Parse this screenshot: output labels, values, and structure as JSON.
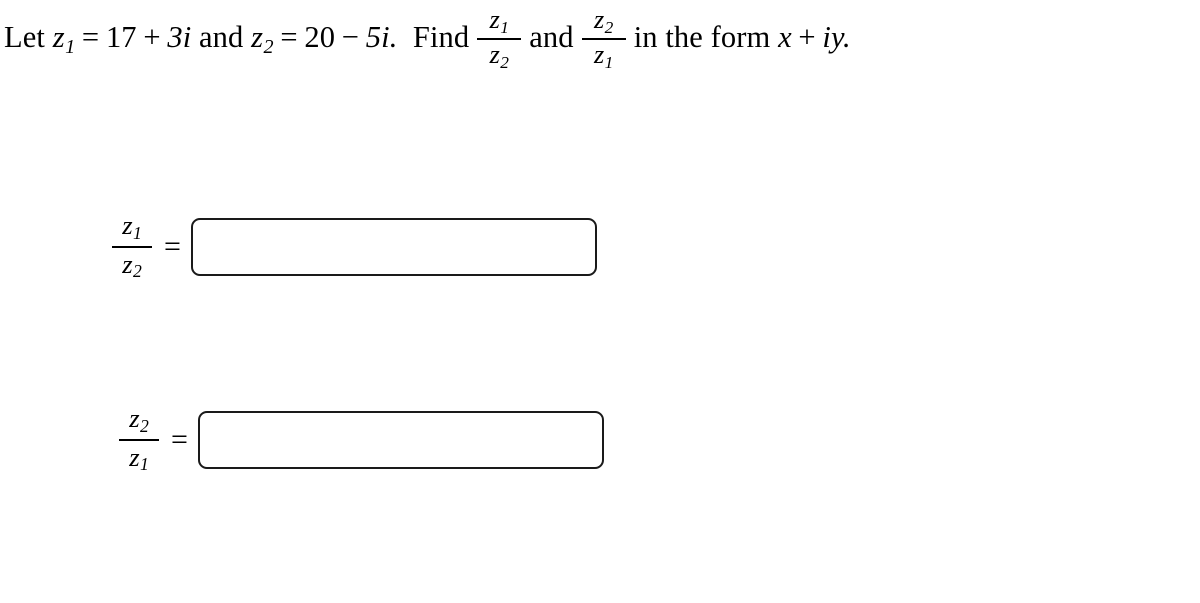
{
  "problem": {
    "intro": "Let",
    "z1_label": "z",
    "z1_sub": "1",
    "equals": "=",
    "z1_value_real": "17",
    "z1_plus": "+",
    "z1_value_imag": "3i",
    "conjunction": "and",
    "z2_label": "z",
    "z2_sub": "2",
    "z2_value_real": "20",
    "z2_minus": "−",
    "z2_value_imag": "5i.",
    "find_word": "Find",
    "frac1_num_var": "z",
    "frac1_num_sub": "1",
    "frac1_den_var": "z",
    "frac1_den_sub": "2",
    "and_word": "and",
    "frac2_num_var": "z",
    "frac2_num_sub": "2",
    "frac2_den_var": "z",
    "frac2_den_sub": "1",
    "tail": "in the form",
    "form_x": "x",
    "form_plus": "+",
    "form_iy": "iy.",
    "full_text": "Let z₁ = 17 + 3i and z₂ = 20 − 5i. Find z₁/z₂ and z₂/z₁ in the form x + iy."
  },
  "answers": [
    {
      "id": "z1-over-z2",
      "numerator_var": "z",
      "numerator_sub": "1",
      "denominator_var": "z",
      "denominator_sub": "2",
      "equals": "=",
      "value": "",
      "placeholder": ""
    },
    {
      "id": "z2-over-z1",
      "numerator_var": "z",
      "numerator_sub": "2",
      "denominator_var": "z",
      "denominator_sub": "1",
      "equals": "=",
      "value": "",
      "placeholder": ""
    }
  ],
  "style": {
    "text_color": "#000000",
    "background": "#ffffff",
    "input_border_color": "#1a1a1a"
  }
}
